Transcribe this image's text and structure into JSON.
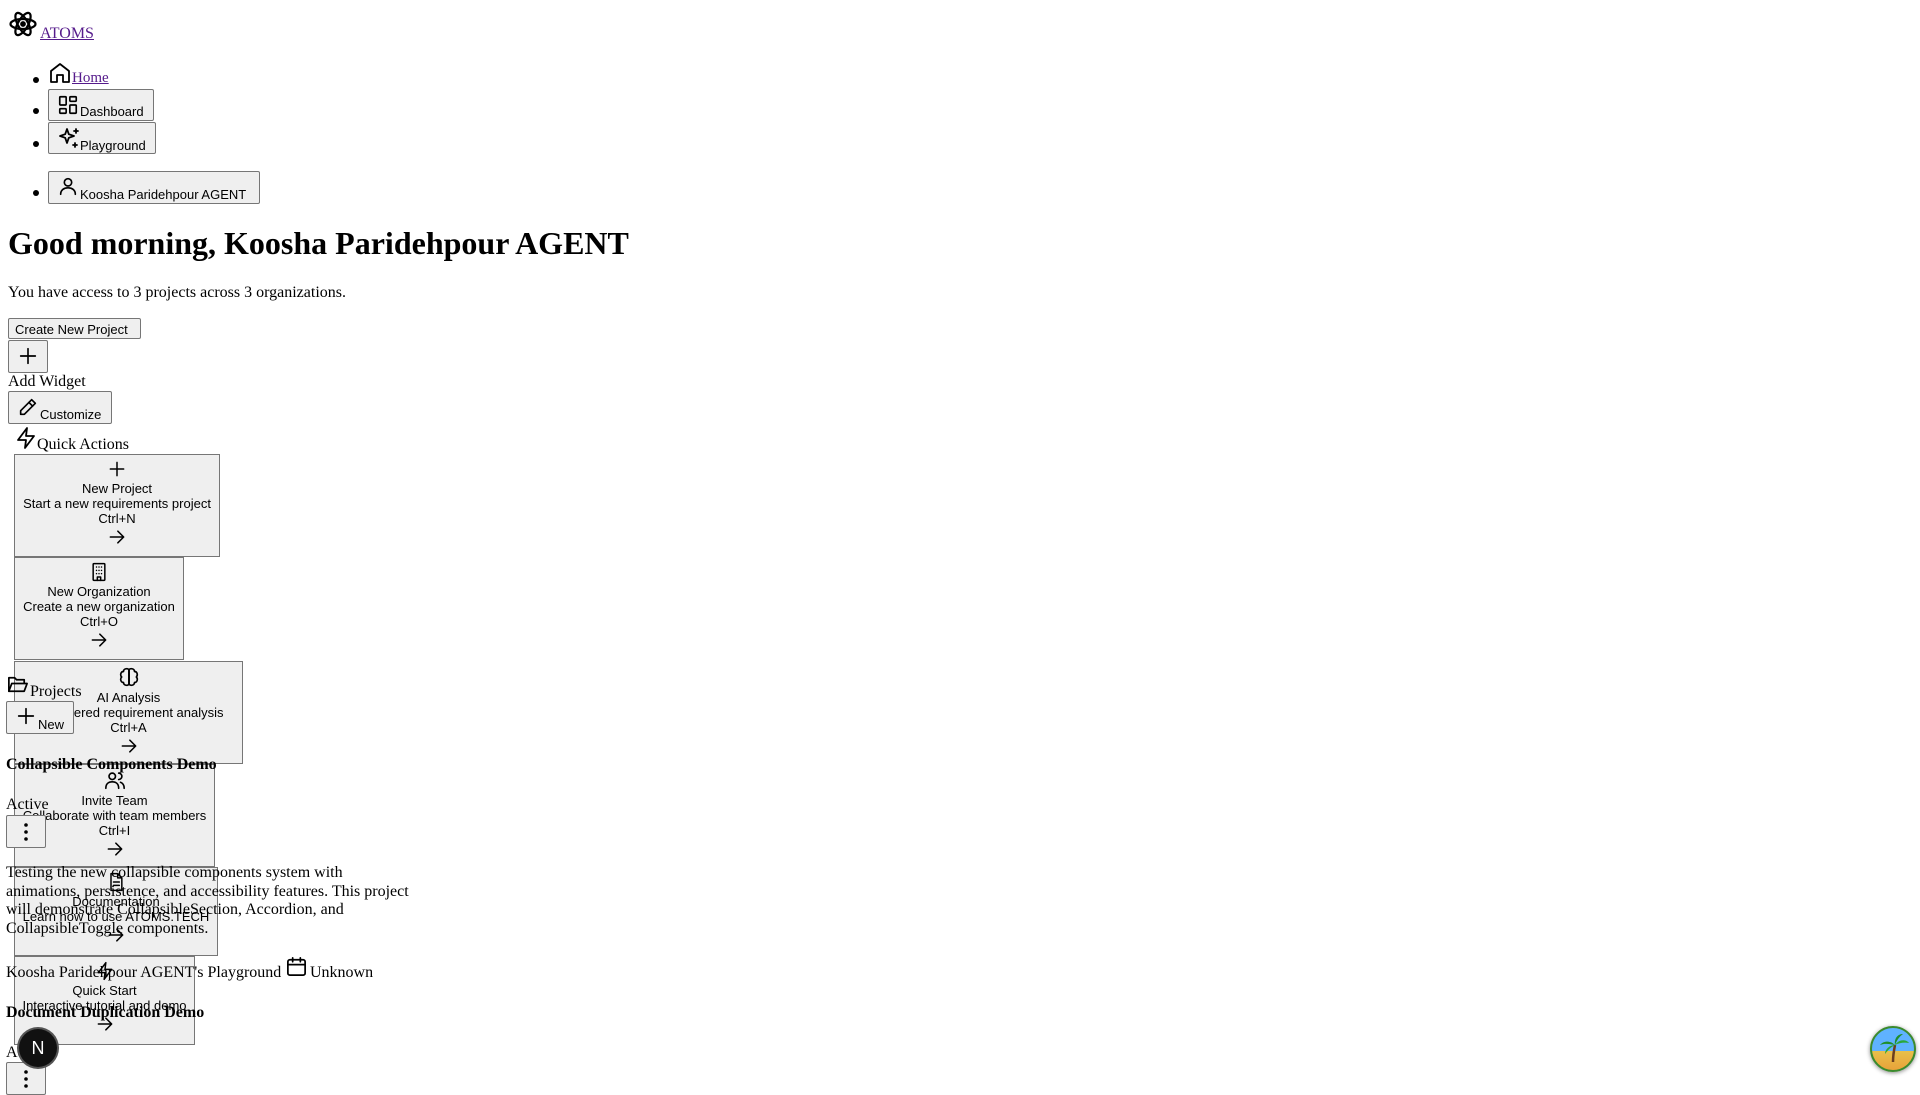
{
  "brand": {
    "name": "ATOMS",
    "icon": "atom-icon"
  },
  "nav": {
    "home": "Home",
    "dashboard": "Dashboard",
    "playground": "Playground",
    "user": "Koosha Paridehpour AGENT"
  },
  "greeting": {
    "title": "Good morning, Koosha Paridehpour AGENT",
    "subtitle": "You have access to 3 projects across 3 organizations."
  },
  "actions": {
    "create_project": "Create New Project",
    "add_widget": "Add Widget",
    "customize": "Customize"
  },
  "quick_actions": {
    "title": "Quick Actions",
    "items": [
      {
        "icon": "plus-icon",
        "title": "New Project",
        "desc": "Start a new requirements project",
        "shortcut": "Ctrl+N"
      },
      {
        "icon": "building-icon",
        "title": "New Organization",
        "desc": "Create a new organization",
        "shortcut": "Ctrl+O"
      },
      {
        "icon": "brain-icon",
        "title": "AI Analysis",
        "desc": "AI-powered requirement analysis",
        "shortcut": "Ctrl+A"
      },
      {
        "icon": "users-icon",
        "title": "Invite Team",
        "desc": "Collaborate with team members",
        "shortcut": "Ctrl+I"
      },
      {
        "icon": "document-icon",
        "title": "Documentation",
        "desc": "Learn how to use ATOMS.TECH",
        "shortcut": ""
      },
      {
        "icon": "zap-icon",
        "title": "Quick Start",
        "desc": "Interactive tutorial and demo",
        "shortcut": ""
      }
    ]
  },
  "projects": {
    "title": "Projects",
    "new_label": "New",
    "items": [
      {
        "name": "Collapsible Components Demo",
        "status": "Active",
        "description": "Testing the new collapsible components system with animations, persistence, and accessibility features. This project will demonstrate CollapsibleSection, Accordion, and CollapsibleToggle components.",
        "org": "Koosha Paridehpour AGENT's Playground",
        "date": "Unknown"
      },
      {
        "name": "Document Duplication Demo",
        "status": "Active"
      }
    ]
  },
  "floating": {
    "avatar_letter": "N"
  }
}
